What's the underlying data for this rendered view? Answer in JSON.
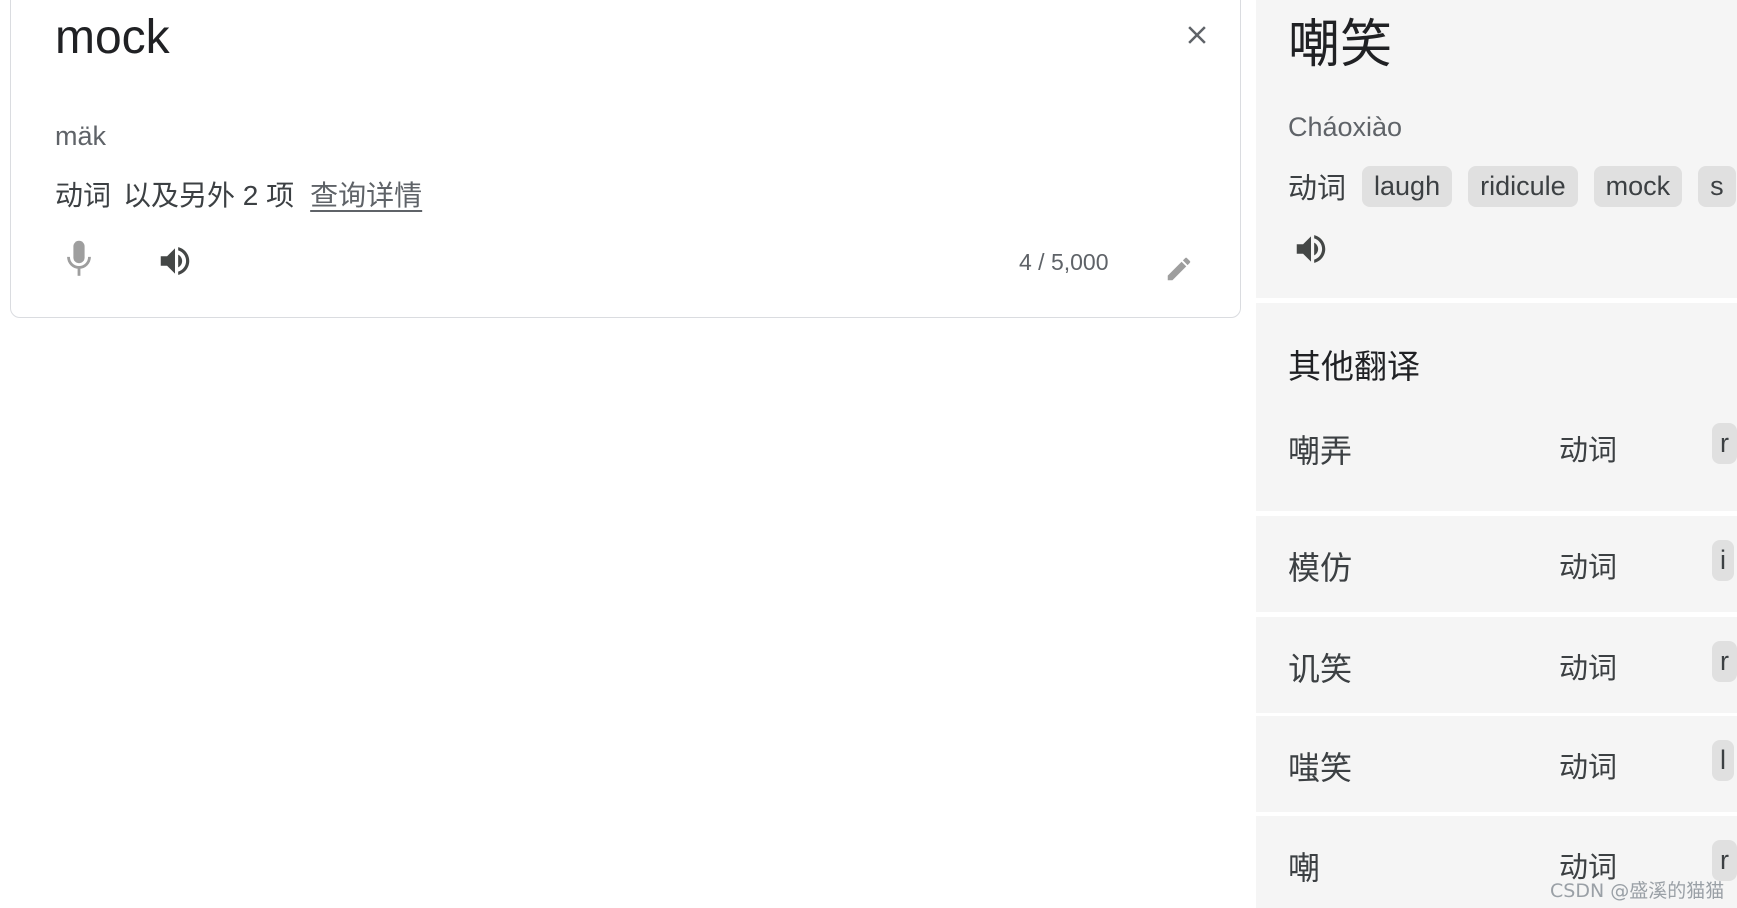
{
  "source": {
    "text": "mock",
    "phonetic": "mäk",
    "part_of_speech": "动词",
    "more_entries": "以及另外 2 项",
    "details_link": "查询详情",
    "char_count": "4 / 5,000",
    "icons": {
      "clear": "close-icon",
      "mic": "microphone-icon",
      "listen": "speaker-icon",
      "edit": "pencil-icon"
    }
  },
  "target": {
    "text": "嘲笑",
    "romanization": "Cháoxiào",
    "part_of_speech": "动词",
    "synonyms": [
      "laugh",
      "ridicule",
      "mock",
      "s"
    ],
    "icons": {
      "listen": "speaker-icon"
    }
  },
  "other_translations": {
    "heading": "其他翻译",
    "rows": [
      {
        "word": "嘲弄",
        "pos": "动词",
        "chip": "r"
      },
      {
        "word": "模仿",
        "pos": "动词",
        "chip": "i"
      },
      {
        "word": "讥笑",
        "pos": "动词",
        "chip": "r"
      },
      {
        "word": "嗤笑",
        "pos": "动词",
        "chip": "l"
      },
      {
        "word": "嘲",
        "pos": "动词",
        "chip": "r"
      }
    ]
  },
  "watermark": "CSDN @盛溪的猫猫",
  "colors": {
    "panel_background": "#f5f5f5",
    "chip_background": "#e0e0e0",
    "text_primary": "#202124",
    "text_secondary": "#5f6368",
    "icon_disabled": "#9e9e9e",
    "border": "#dadce0"
  }
}
